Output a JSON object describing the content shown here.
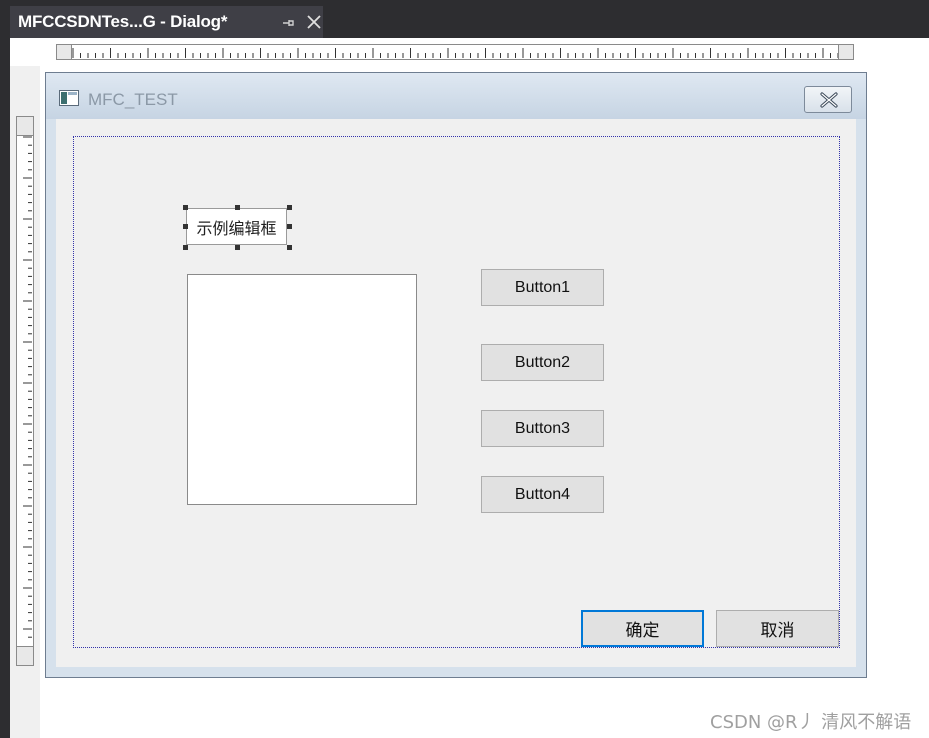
{
  "tab": {
    "title": "MFCCSDNTes...G - Dialog*",
    "pin_icon": "pin-icon",
    "close_icon": "close-icon"
  },
  "dialog": {
    "title": "MFC_TEST",
    "icon": "dialog-app-icon",
    "close_icon": "close-icon"
  },
  "controls": {
    "edit_text": "示例编辑框",
    "buttons": [
      "Button1",
      "Button2",
      "Button3",
      "Button4"
    ],
    "ok_label": "确定",
    "cancel_label": "取消"
  },
  "watermark": "CSDN @R丿 清风不解语",
  "colors": {
    "chrome_dark": "#2d2d30",
    "tab_bg": "#3f3f46",
    "dialog_client": "#f0f0f0",
    "default_button_border": "#0078d7"
  }
}
